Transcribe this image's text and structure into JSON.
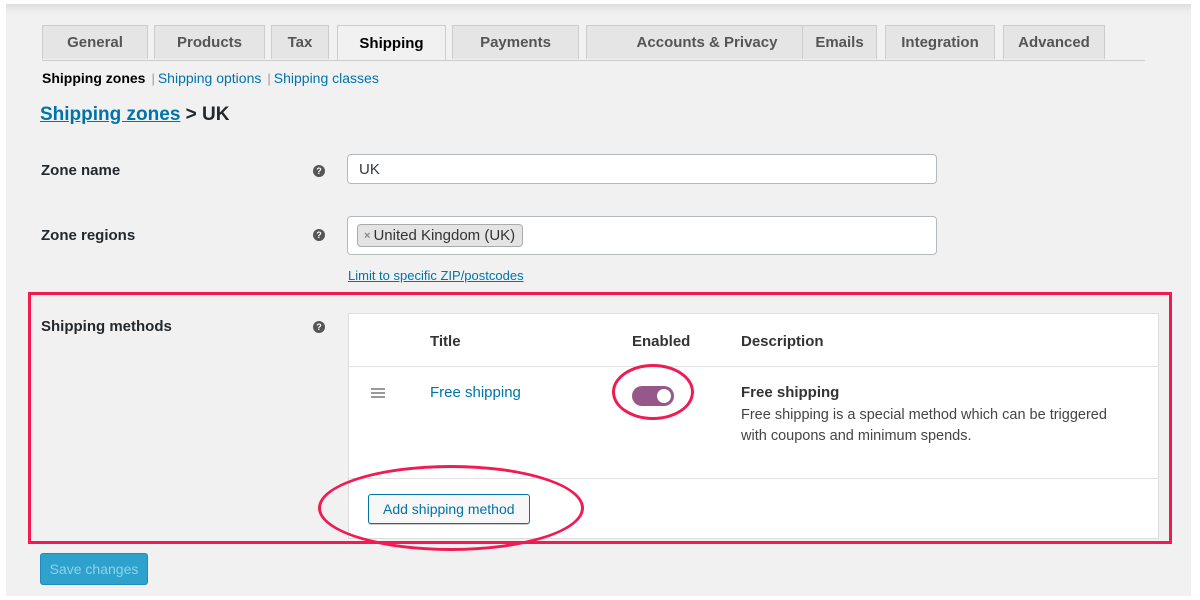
{
  "tabs": [
    {
      "label": "General",
      "active": false
    },
    {
      "label": "Products",
      "active": false
    },
    {
      "label": "Tax",
      "active": false
    },
    {
      "label": "Shipping",
      "active": true
    },
    {
      "label": "Payments",
      "active": false
    },
    {
      "label": "Accounts & Privacy",
      "active": false
    },
    {
      "label": "Emails",
      "active": false
    },
    {
      "label": "Integration",
      "active": false
    },
    {
      "label": "Advanced",
      "active": false
    }
  ],
  "subnav": {
    "current": "Shipping zones",
    "separator": "|",
    "links": [
      "Shipping options",
      "Shipping classes"
    ]
  },
  "breadcrumb": {
    "link": "Shipping zones",
    "current": "> UK"
  },
  "form": {
    "zone_name": {
      "label": "Zone name",
      "value": "UK",
      "help_icon": "question-circle-icon"
    },
    "zone_regions": {
      "label": "Zone regions",
      "chips": [
        {
          "remove_glyph": "×",
          "label": "United Kingdom (UK)"
        }
      ],
      "limit_link": "Limit to specific ZIP/postcodes",
      "help_icon": "question-circle-icon"
    },
    "shipping_methods": {
      "label": "Shipping methods",
      "help_icon": "question-circle-icon",
      "columns": [
        "Title",
        "Enabled",
        "Description"
      ],
      "rows": [
        {
          "title": "Free shipping",
          "enabled": true,
          "description_title": "Free shipping",
          "description": "Free shipping is a special method which can be triggered with coupons and minimum spends."
        }
      ],
      "add_button": "Add shipping method"
    }
  },
  "save_button": "Save changes",
  "colors": {
    "accent_link": "#0073aa",
    "toggle_on": "#96588a",
    "annotation": "#ef1b52",
    "primary_button": "#2ea2cc",
    "page_bg": "#f1f1f1"
  }
}
